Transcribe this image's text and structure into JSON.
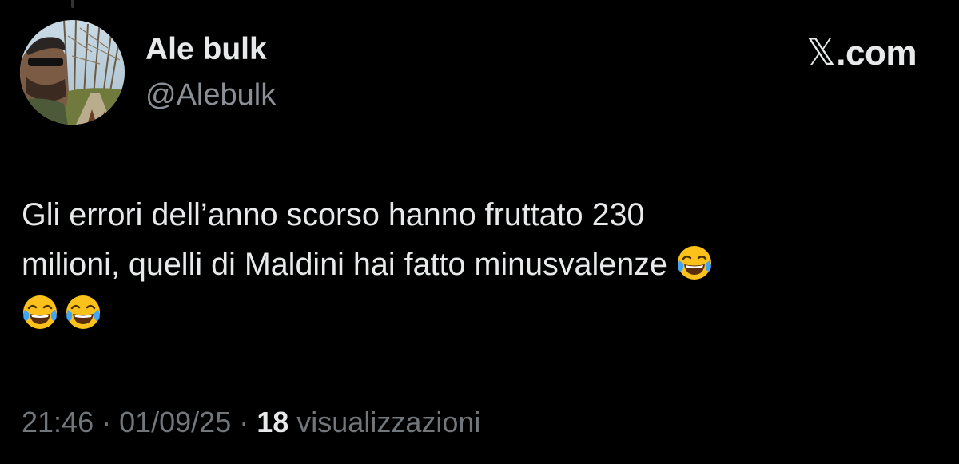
{
  "author": {
    "display_name": "Ale bulk",
    "handle": "@Alebulk",
    "avatar": "profile-photo-icon"
  },
  "brand": {
    "glyph": "𝕏",
    "label": ".com"
  },
  "tweet": {
    "text_line1": "Gli errori dell’anno scorso hanno fruttato 230",
    "text_line2": "milioni, quelli di Maldini hai fatto minusvalenze",
    "emoji": "face-with-tears-of-joy-icon",
    "emoji_count": 3
  },
  "meta": {
    "time": "21:46",
    "sep1": " · ",
    "date": "01/09/25",
    "sep2": " · ",
    "views_count": "18",
    "views_label": " visualizzazioni"
  },
  "colors": {
    "background": "#000000",
    "primary_text": "#e7e9ea",
    "secondary_text": "#71767b",
    "handle_text": "#8b9097"
  }
}
